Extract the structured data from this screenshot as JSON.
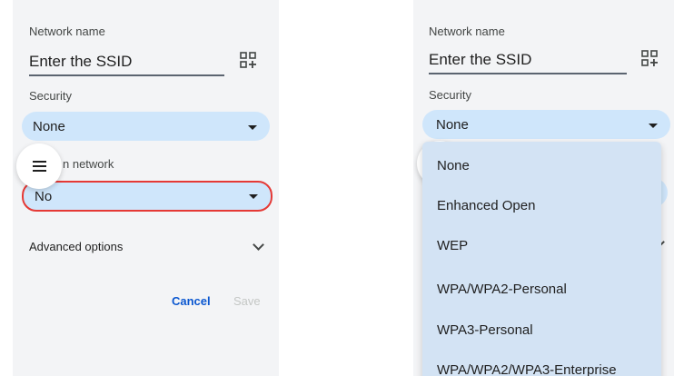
{
  "left_panel": {
    "network_name_label": "Network name",
    "ssid_placeholder": "Enter the SSID",
    "security_label": "Security",
    "security_value": "None",
    "hidden_network_label_visible": "n network",
    "hidden_network_value": "No",
    "advanced_options_label": "Advanced options",
    "cancel_label": "Cancel",
    "save_label": "Save"
  },
  "right_panel": {
    "network_name_label": "Network name",
    "ssid_placeholder": "Enter the SSID",
    "security_label": "Security",
    "security_value": "None",
    "security_options": [
      "None",
      "Enhanced Open",
      "WEP",
      "WPA/WPA2-Personal",
      "WPA3-Personal",
      "WPA/WPA2/WPA3-Enterprise"
    ]
  },
  "icons": {
    "qr": "qr-code-scan-icon",
    "menu": "hamburger-menu-icon",
    "dropdown": "caret-down-icon",
    "expand": "chevron-down-icon"
  },
  "colors": {
    "panel_bg": "#f3f4f6",
    "pill_bg": "#cfe6fb",
    "menu_bg": "#d3e3f4",
    "highlight": "#e53935",
    "primary": "#0b57d0",
    "disabled": "#c4c7c5"
  }
}
